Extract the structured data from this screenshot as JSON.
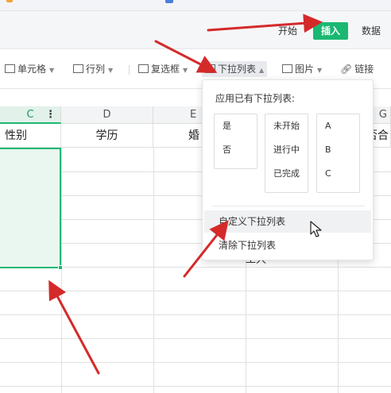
{
  "ribbon": {
    "tabs": [
      {
        "label": "开始"
      },
      {
        "label": "插入"
      },
      {
        "label": "数据"
      }
    ]
  },
  "toolbar": {
    "cell_label": "单元格",
    "rowcol_label": "行列",
    "checkbox_label": "复选框",
    "dropdown_label": "下拉列表",
    "picture_label": "图片",
    "link_label": "链接"
  },
  "sheet": {
    "columns": [
      "C",
      "D",
      "E",
      "G"
    ],
    "headers": [
      "性别",
      "学历",
      "婚",
      "否合"
    ],
    "partial_cell": "工人"
  },
  "dropdown_panel": {
    "title": "应用已有下拉列表:",
    "option_groups": [
      [
        "是",
        "否"
      ],
      [
        "未开始",
        "进行中",
        "已完成"
      ],
      [
        "A",
        "B",
        "C"
      ]
    ],
    "menu": {
      "custom": "自定义下拉列表",
      "clear": "清除下拉列表"
    }
  },
  "colors": {
    "accent": "#1ab872",
    "arrow": "#d42a2a"
  }
}
